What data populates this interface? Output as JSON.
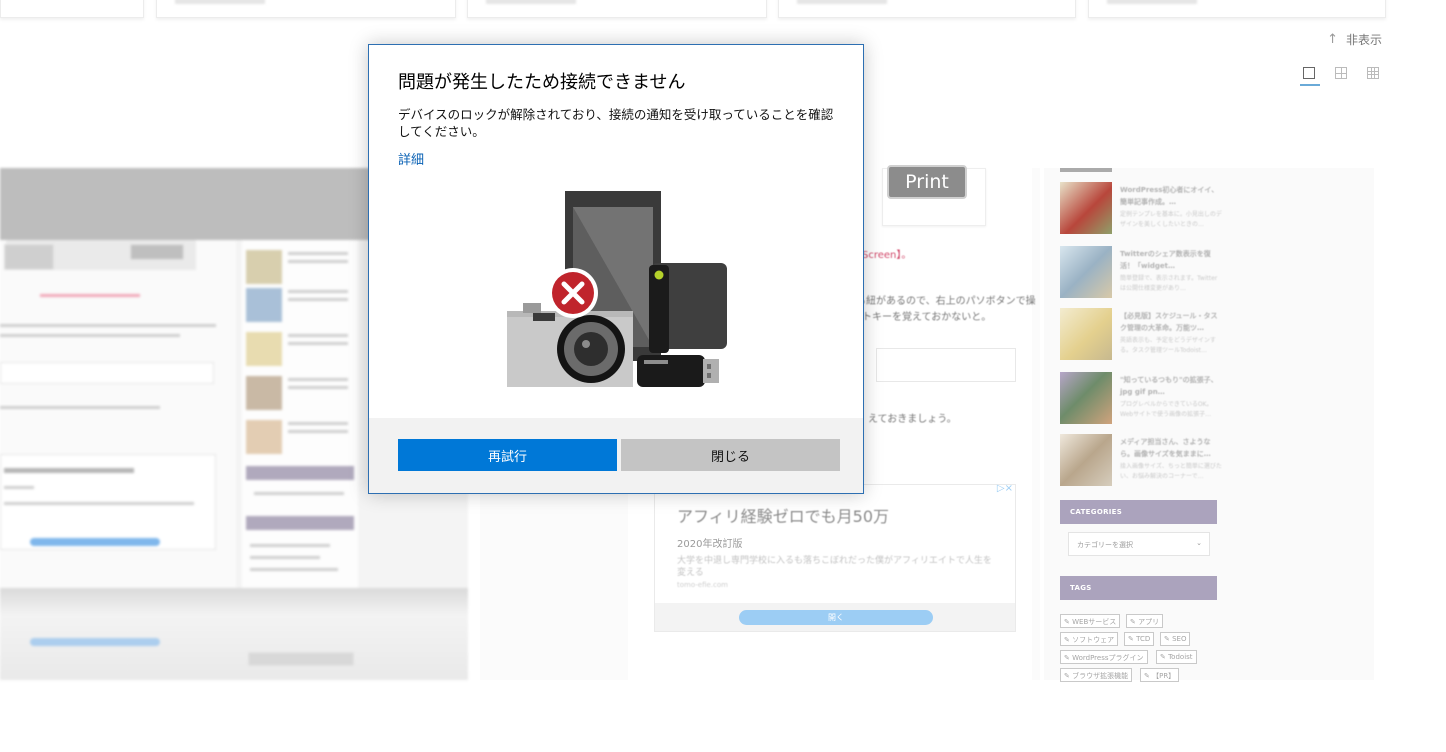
{
  "background": {
    "hide_label": "非表示",
    "hide_icon": "arrow-up-icon",
    "view_modes": [
      "single-view-icon",
      "grid-2-view-icon",
      "grid-3-view-icon"
    ],
    "print_screen_key": "Print Screen",
    "article_link_fragment": "Screen】。",
    "article_line_1": "る紐があるので、右上のパソボタンで操",
    "article_line_2": "トキーを覚えておかないと。",
    "article_line_3": "えておきましょう。",
    "ad": {
      "title": "アフィリ経験ゼロでも月50万",
      "subtitle": "2020年改訂版",
      "description": "大学を中退し専門学校に入るも落ちこぼれだった僕がアフィリエイトで人生を変える",
      "url": "tomo-efie.com",
      "open_button": "開く",
      "close_mark": "▷×"
    },
    "sidebar": {
      "posts": [
        {
          "title": "WordPress初心者にオイイ、簡単記事作成。…",
          "desc": "定例テンプレを基本に。小見出しのデザインを美しくしたいときの…"
        },
        {
          "title": "Twitterのシェア数表示を復活！「widget…",
          "desc": "簡単登録で、表示されます。Twitterは公開仕様変更があり…"
        },
        {
          "title": "【必見版】スケジュール・タスク管理の大革命。万能ツ…",
          "desc": "英語表示も、予定をどうデザインする。タスク管理ツールTodoist…"
        },
        {
          "title": "\"知っているつもり\"の拡張子、jpg gif pn…",
          "desc": "プログレベルからできているOK。Webサイトで使う画像の拡張子…"
        },
        {
          "title": "メディア担当さん、さようなら。画像サイズを気ままに…",
          "desc": "捨入画像サイズ、ちっと簡単に選びたい、お悩み解決のコーナーで…"
        }
      ],
      "categories_heading": "CATEGORIES",
      "categories_select": "カテゴリーを選択",
      "tags_heading": "TAGS",
      "tags": [
        "WEBサービス",
        "アプリ",
        "ソフトウェア",
        "TCD",
        "SEO",
        "WordPressプラグイン",
        "Todoist",
        "ブラウザ拡張機能",
        "【PR】"
      ]
    }
  },
  "dialog": {
    "title": "問題が発生したため接続できません",
    "message": "デバイスのロックが解除されており、接続の通知を受け取っていることを確認してください。",
    "details_link": "詳細",
    "illustration_icon": "devices-error-icon",
    "retry_button": "再試行",
    "close_button": "閉じる",
    "colors": {
      "accent": "#0078d7",
      "border": "#2d6fb2",
      "error": "#c0242c",
      "link": "#0a62b5"
    }
  }
}
